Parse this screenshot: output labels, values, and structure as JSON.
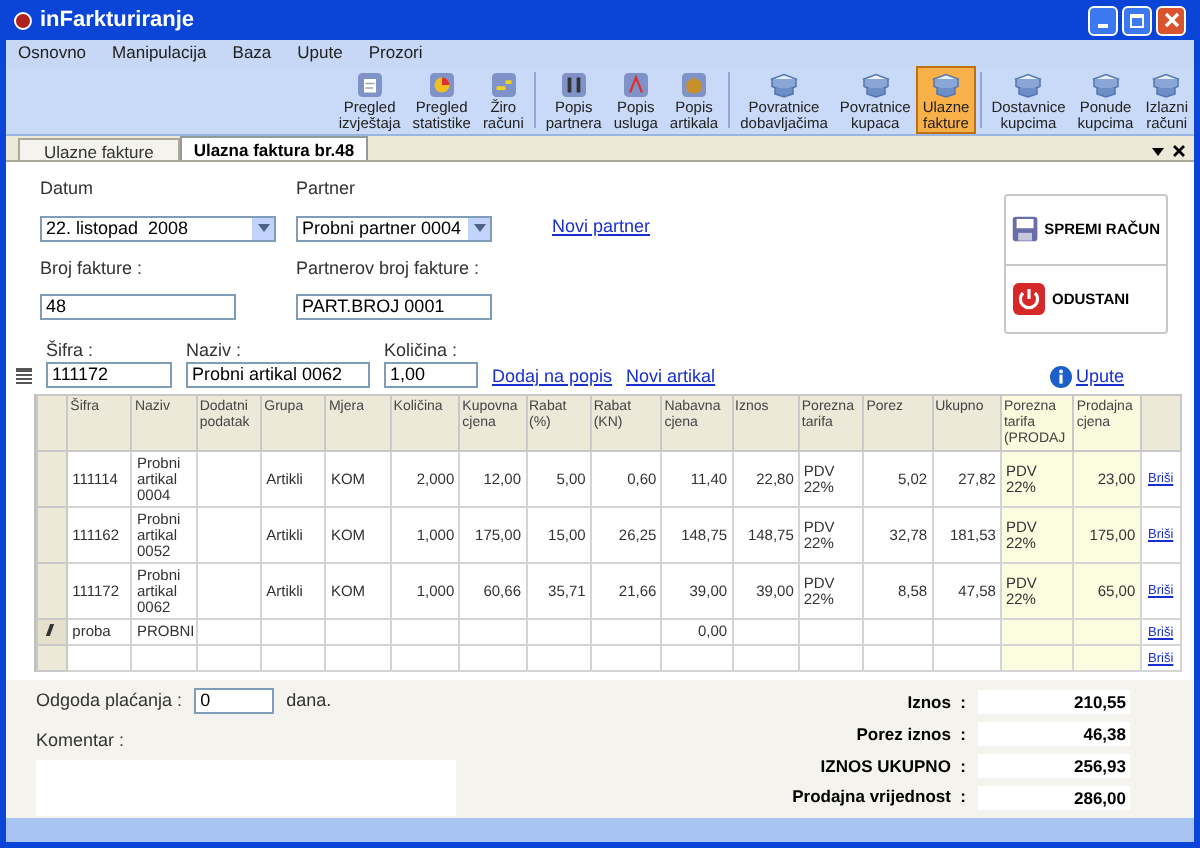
{
  "window": {
    "title": "inFarkturiranje"
  },
  "menu": [
    "Osnovno",
    "Manipulacija",
    "Baza",
    "Upute",
    "Prozori"
  ],
  "toolbar": [
    {
      "label_lines": [
        "Pregled",
        "izvještaja"
      ],
      "selected": false
    },
    {
      "label_lines": [
        "Pregled",
        "statistike"
      ],
      "selected": false
    },
    {
      "label_lines": [
        "Žiro",
        "računi"
      ],
      "selected": false
    },
    {
      "label_lines": [
        "Popis",
        "partnera"
      ],
      "selected": false
    },
    {
      "label_lines": [
        "Popis",
        "usluga"
      ],
      "selected": false
    },
    {
      "label_lines": [
        "Popis",
        "artikala"
      ],
      "selected": false
    },
    {
      "label_lines": [
        "Povratnice",
        "dobavljačima"
      ],
      "selected": false
    },
    {
      "label_lines": [
        "Povratnice",
        "kupaca"
      ],
      "selected": false
    },
    {
      "label_lines": [
        "Ulazne",
        "fakture"
      ],
      "selected": true
    },
    {
      "label_lines": [
        "Dostavnice",
        "kupcima"
      ],
      "selected": false
    },
    {
      "label_lines": [
        "Ponude",
        "kupcima"
      ],
      "selected": false
    },
    {
      "label_lines": [
        "Izlazni",
        "računi"
      ],
      "selected": false
    }
  ],
  "tabs": [
    {
      "label": "Ulazne fakture",
      "selected": false
    },
    {
      "label": "Ulazna faktura br.48",
      "selected": true
    }
  ],
  "form": {
    "datum_label": "Datum",
    "datum": "22. listopad  2008",
    "partner_label": "Partner",
    "partner": "Probni partner 0004",
    "novi_partner": "Novi partner",
    "broj_label": "Broj fakture :",
    "broj": "48",
    "partnerov_label": "Partnerov broj fakture :",
    "partnerov": "PART.BROJ 0001",
    "sifra_label": "Šifra :",
    "sifra": "111172",
    "naziv_label": "Naziv :",
    "naziv": "Probni artikal 0062",
    "kolicina_label": "Količina :",
    "kolicina": "1,00",
    "dodaj": "Dodaj na popis",
    "novi_artikal": "Novi artikal",
    "upute": "Upute"
  },
  "actions": [
    {
      "label": "SPREMI RAČUN"
    },
    {
      "label": "ODUSTANI"
    }
  ],
  "table": {
    "columns": [
      {
        "label": "Šifra",
        "highlighted": false
      },
      {
        "label": "Naziv",
        "highlighted": false
      },
      {
        "label": "Dodatni podatak",
        "highlighted": false
      },
      {
        "label": "Grupa",
        "highlighted": false
      },
      {
        "label": "Mjera",
        "highlighted": false
      },
      {
        "label": "Količina",
        "highlighted": false
      },
      {
        "label": "Kupovna cjena",
        "highlighted": false
      },
      {
        "label": "Rabat (%)",
        "highlighted": false
      },
      {
        "label": "Rabat (KN)",
        "highlighted": false
      },
      {
        "label": "Nabavna cjena",
        "highlighted": false
      },
      {
        "label": "Iznos",
        "highlighted": false
      },
      {
        "label": "Porezna tarifa",
        "highlighted": false
      },
      {
        "label": "Porez",
        "highlighted": false
      },
      {
        "label": "Ukupno",
        "highlighted": false
      },
      {
        "label": "Porezna tarifa (PRODAJ",
        "highlighted": true
      },
      {
        "label": "Prodajna cjena",
        "highlighted": true
      }
    ],
    "rows": [
      {
        "editing": false,
        "cells": [
          "111114",
          "Probni artikal 0004",
          null,
          "Artikli",
          "KOM",
          "2,000",
          "12,00",
          "5,00",
          "0,60",
          "11,40",
          "22,80",
          "PDV 22%",
          "5,02",
          "27,82",
          "PDV 22%",
          "23,00"
        ],
        "action": "Briši"
      },
      {
        "editing": false,
        "cells": [
          "111162",
          "Probni artikal 0052",
          null,
          "Artikli",
          "KOM",
          "1,000",
          "175,00",
          "15,00",
          "26,25",
          "148,75",
          "148,75",
          "PDV 22%",
          "32,78",
          "181,53",
          "PDV 22%",
          "175,00"
        ],
        "action": "Briši"
      },
      {
        "editing": false,
        "cells": [
          "111172",
          "Probni artikal 0062",
          null,
          "Artikli",
          "KOM",
          "1,000",
          "60,66",
          "35,71",
          "21,66",
          "39,00",
          "39,00",
          "PDV 22%",
          "8,58",
          "47,58",
          "PDV 22%",
          "65,00"
        ],
        "action": "Briši"
      },
      {
        "editing": true,
        "cells": [
          "proba",
          "PROBNI",
          null,
          null,
          null,
          null,
          null,
          null,
          null,
          "0,00",
          null,
          null,
          null,
          null,
          null,
          null
        ],
        "action": "Briši"
      },
      {
        "editing": false,
        "cells": [
          null,
          null,
          null,
          null,
          null,
          null,
          null,
          null,
          null,
          null,
          null,
          null,
          null,
          null,
          null,
          null
        ],
        "action": "Briši"
      }
    ]
  },
  "odgoda": {
    "label": "Odgoda plaćanja :",
    "value": "0",
    "suffix": "dana."
  },
  "komentar": {
    "label": "Komentar :"
  },
  "totals": [
    {
      "label": "Iznos  :",
      "value": "210,55"
    },
    {
      "label": "Porez iznos  :",
      "value": "46,38"
    },
    {
      "label": "IZNOS UKUPNO  :",
      "value": "256,93"
    },
    {
      "label": "Prodajna vrijednost  :",
      "value": "286,00"
    }
  ]
}
